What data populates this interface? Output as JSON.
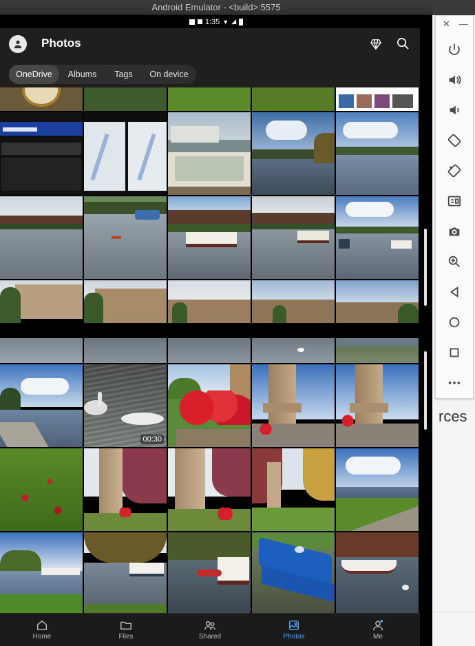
{
  "window": {
    "title": "Android Emulator - <build>:5575"
  },
  "status_bar": {
    "time": "1:35"
  },
  "app": {
    "title": "Photos",
    "tabs": [
      {
        "label": "OneDrive",
        "active": true
      },
      {
        "label": "Albums",
        "active": false
      },
      {
        "label": "Tags",
        "active": false
      },
      {
        "label": "On device",
        "active": false
      }
    ]
  },
  "video": {
    "duration": "00:30"
  },
  "bottom_nav": [
    {
      "label": "Home",
      "icon": "home-icon",
      "active": false
    },
    {
      "label": "Files",
      "icon": "folder-icon",
      "active": false
    },
    {
      "label": "Shared",
      "icon": "people-icon",
      "active": false
    },
    {
      "label": "Photos",
      "icon": "photo-icon",
      "active": true
    },
    {
      "label": "Me",
      "icon": "person-icon",
      "active": false
    }
  ],
  "emulator_controls": [
    "close-icon",
    "minimize-icon",
    "power-icon",
    "volume-up-icon",
    "volume-down-icon",
    "rotate-left-icon",
    "rotate-right-icon",
    "screenshot-icon",
    "camera-icon",
    "zoom-icon",
    "back-icon",
    "home-circle-icon",
    "overview-icon",
    "more-icon"
  ],
  "background_text": "rces",
  "colors": {
    "accent": "#4ea1ff",
    "app_bg": "#1f1f1f"
  }
}
